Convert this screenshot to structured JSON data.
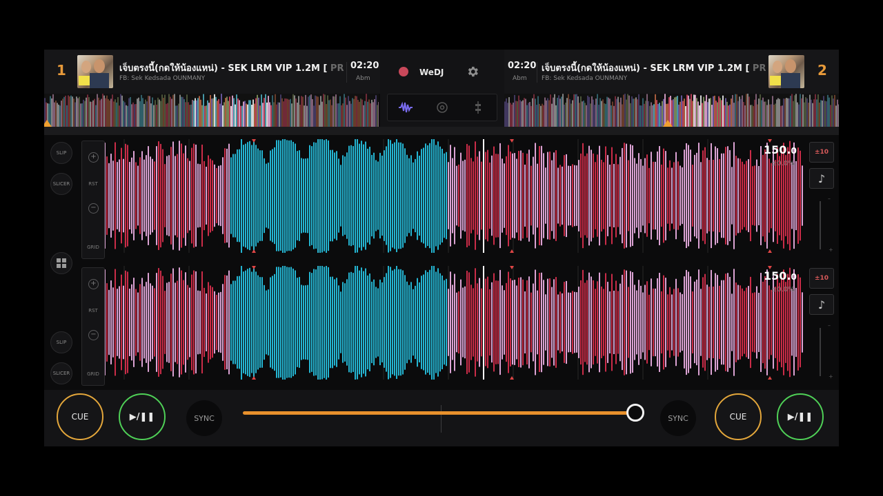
{
  "deck1": {
    "number": "1",
    "title": "เจ็บตรงนี้(กดให้น้องแหน่) - SEK LRM VIP 1.2M [",
    "title_fade": " PRIVA",
    "artist": "FB: Sek Kedsada OUNMANY",
    "time": "02:20",
    "key": "Abm",
    "bpm": "150.",
    "bpm_decimal": "0",
    "pitch": "±0.0%",
    "pitch_range": "±10",
    "playhead_fraction": 0.0
  },
  "deck2": {
    "number": "2",
    "title": "เจ็บตรงนี้(กดให้น้องแหน่) - SEK LRM VIP 1.2M [",
    "title_fade": " PRIVA",
    "artist": "FB: Sek Kedsada OUNMANY",
    "time": "02:20",
    "key": "Abm",
    "bpm": "150.",
    "bpm_decimal": "0",
    "pitch": "±0.0%",
    "pitch_range": "±10",
    "playhead_fraction": 0.42
  },
  "center": {
    "app_title": "WeDJ",
    "record_icon": "record-icon",
    "settings_icon": "gear-icon"
  },
  "side_buttons": {
    "slip": "SLIP",
    "slicer": "SLICER",
    "grid": "GRID",
    "rst": "RST",
    "plus": "+",
    "minus": "−"
  },
  "controls": {
    "cue_label": "CUE",
    "play_label": "▶/❚❚",
    "sync_label": "SYNC",
    "crossfader_position": 0.99
  },
  "colors": {
    "accent_orange": "#e8912c",
    "cue_ring": "#e4a73b",
    "play_ring": "#4fd157",
    "wave_cyan": "#27c8e8",
    "wave_red": "#e0304f",
    "wave_pink": "#f3b4ea"
  }
}
